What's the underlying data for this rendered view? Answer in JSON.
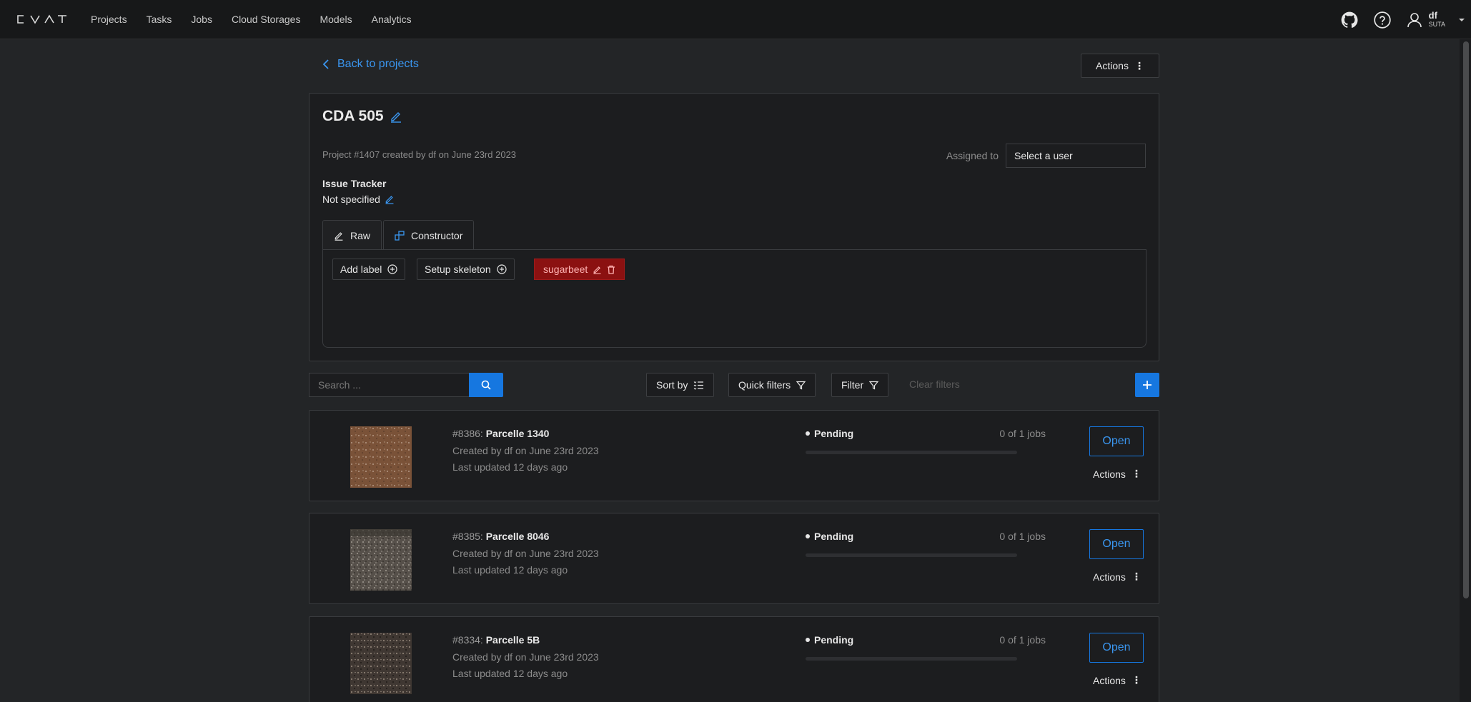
{
  "app": {
    "logo": "CVAT",
    "nav": [
      "Projects",
      "Tasks",
      "Jobs",
      "Cloud Storages",
      "Models",
      "Analytics"
    ],
    "icons": {
      "github": "github-icon",
      "help": "help-icon",
      "user": "user-icon",
      "dropdown": "caret-down-icon"
    },
    "user": {
      "name": "df",
      "org": "SUTA"
    }
  },
  "page": {
    "back_label": "Back to projects",
    "actions_label": "Actions"
  },
  "project": {
    "title": "CDA 505",
    "meta": "Project #1407 created by df on June 23rd 2023",
    "assigned_label": "Assigned to",
    "assigned_placeholder": "Select a user",
    "issue_tracker_label": "Issue Tracker",
    "issue_tracker_value": "Not specified",
    "tabs": [
      {
        "label": "Raw",
        "icon": "edit-icon"
      },
      {
        "label": "Constructor",
        "icon": "build-icon",
        "active": true
      }
    ],
    "add_label": "Add label",
    "setup_skeleton": "Setup skeleton",
    "labels": [
      {
        "name": "sugarbeet",
        "color": "#8b1111"
      }
    ]
  },
  "toolbar": {
    "search_placeholder": "Search ...",
    "sort_by": "Sort by",
    "quick_filters": "Quick filters",
    "filter": "Filter",
    "clear_filters": "Clear filters"
  },
  "tasks": [
    {
      "id": "#8386:",
      "name": "Parcelle 1340",
      "created": "Created by df on June 23rd 2023",
      "updated": "Last updated 12 days ago",
      "status": "Pending",
      "jobs": "0 of 1 jobs",
      "progress": 0,
      "open": "Open",
      "actions": "Actions"
    },
    {
      "id": "#8385:",
      "name": "Parcelle 8046",
      "created": "Created by df on June 23rd 2023",
      "updated": "Last updated 12 days ago",
      "status": "Pending",
      "jobs": "0 of 1 jobs",
      "progress": 0,
      "open": "Open",
      "actions": "Actions"
    },
    {
      "id": "#8334:",
      "name": "Parcelle 5B",
      "created": "Created by df on June 23rd 2023",
      "updated": "Last updated 12 days ago",
      "status": "Pending",
      "jobs": "0 of 1 jobs",
      "progress": 0,
      "open": "Open",
      "actions": "Actions"
    }
  ],
  "colors": {
    "accent": "#1677e0",
    "link": "#3a96f0",
    "label_red": "#8b1111",
    "background": "#232527",
    "panel": "#1c1d1f"
  }
}
